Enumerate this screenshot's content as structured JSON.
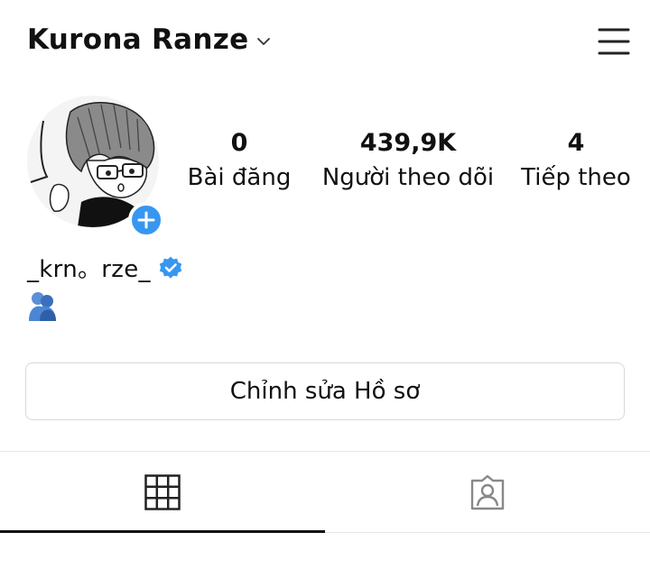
{
  "header": {
    "username": "Kurona Ranze",
    "dropdown_icon": "chevron-down-icon",
    "menu_icon": "hamburger-menu-icon"
  },
  "profile": {
    "avatar": "profile-avatar-manga-illustration",
    "add_icon": "plus-icon",
    "stats": [
      {
        "value": "0",
        "label": "Bài đăng"
      },
      {
        "value": "439,9K",
        "label": "Người theo dõi"
      },
      {
        "value": "4",
        "label": "Tiếp theo"
      }
    ],
    "handle": "_krn。rze_",
    "verified_icon": "verified-badge-icon",
    "bio_emoji": "people-hugging-emoji"
  },
  "actions": {
    "edit_profile": "Chỉnh sửa Hồ sơ"
  },
  "tabs": {
    "grid_icon": "grid-icon",
    "tagged_icon": "tagged-person-icon",
    "active": "grid"
  },
  "colors": {
    "accent_blue": "#3797f0",
    "text": "#111111",
    "border": "#d8d8d8",
    "divider": "#e6e6e6"
  }
}
